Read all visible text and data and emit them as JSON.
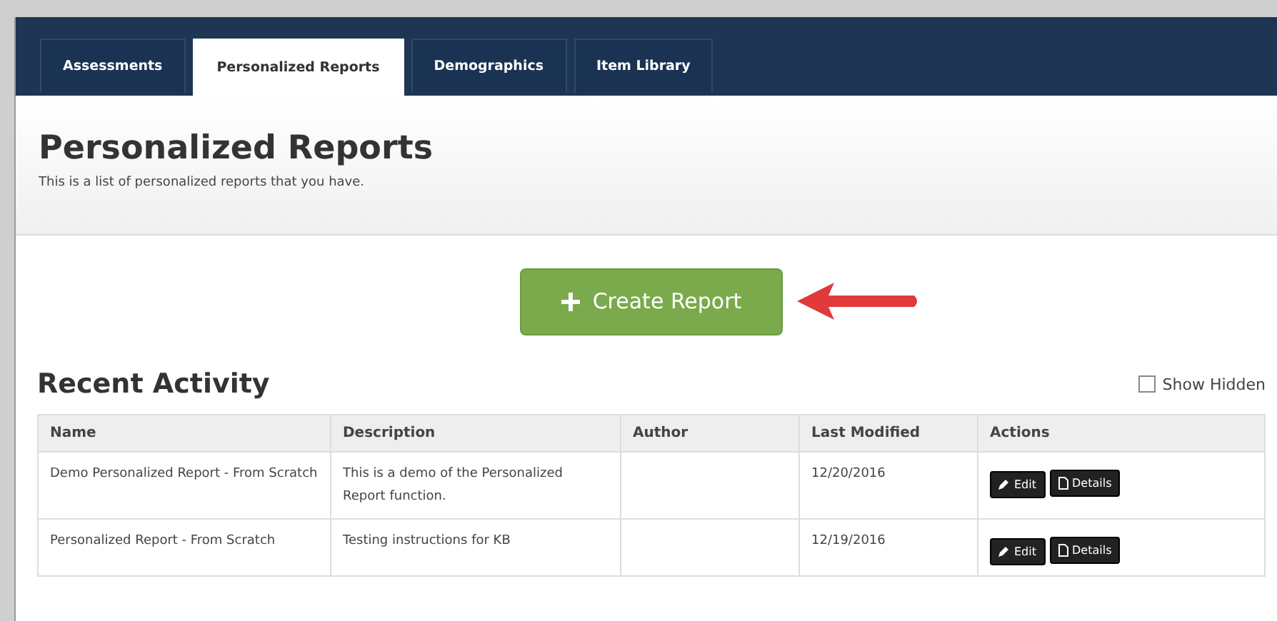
{
  "tabs": [
    {
      "label": "Assessments",
      "selected": false
    },
    {
      "label": "Personalized Reports",
      "selected": true
    },
    {
      "label": "Demographics",
      "selected": false
    },
    {
      "label": "Item Library",
      "selected": false
    }
  ],
  "header": {
    "title": "Personalized Reports",
    "subtitle": "This is a list of personalized reports that you have."
  },
  "create_button": {
    "label": "Create Report"
  },
  "recent_activity": {
    "title": "Recent Activity",
    "show_hidden": {
      "label": "Show Hidden",
      "checked": false
    },
    "columns": [
      "Name",
      "Description",
      "Author",
      "Last Modified",
      "Actions"
    ],
    "rows": [
      {
        "name": "Demo Personalized Report - From Scratch",
        "description": "This is a demo of the Personalized Report function.",
        "author": "",
        "modified": "12/20/2016",
        "actions": [
          "Edit",
          "Details"
        ]
      },
      {
        "name": "Personalized Report - From Scratch",
        "description": "Testing instructions for KB",
        "author": "",
        "modified": "12/19/2016",
        "actions": [
          "Edit",
          "Details"
        ]
      }
    ]
  }
}
